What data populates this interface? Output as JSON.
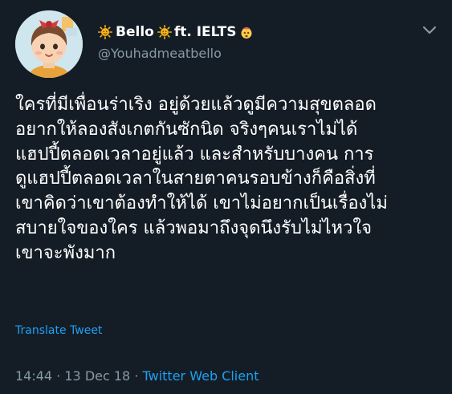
{
  "tweet": {
    "author": {
      "display_name_left_emoji": "🌞",
      "display_name": "Bello",
      "display_name_right_emoji": "🌞",
      "display_name_suffix": " ft. IELTS",
      "display_name_end_emoji": "🤯",
      "handle": "@Youhadmeatbello"
    },
    "body_lines": [
      "ใครที่มีเพื่อนร่าเริง อยู่ด้วยแล้วดูมีความสุขตลอด",
      "อยากให้ลองสังเกตกันซักนิด จริงๆคนเราไม่ได้",
      "แฮปปี้ตลอดเวลาอยู่แล้ว และสำหรับบางคน การ",
      "ดูแฮปปี้ตลอดเวลาในสายตาคนรอบข้างก็คือสิ่งที่",
      "เขาคิดว่าเขาต้องทำให้ได้ เขาไม่อยากเป็นเรื่องไม่",
      "สบายใจของใคร แล้วพอมาถึงจุดนึงรับไม่ไหวใจ",
      "เขาจะพังมาก"
    ],
    "translate_label": "Translate Tweet",
    "meta": {
      "time": "14:44",
      "separator1": " · ",
      "date": "13 Dec 18",
      "separator2": " · ",
      "client": "Twitter Web Client"
    }
  },
  "colors": {
    "background": "#141d26",
    "text_primary": "#ffffff",
    "text_secondary": "#8899a6",
    "link": "#1da1f2"
  },
  "icons": {
    "avatar": "cartoon-girl-avatar",
    "menu": "chevron-down-icon"
  }
}
